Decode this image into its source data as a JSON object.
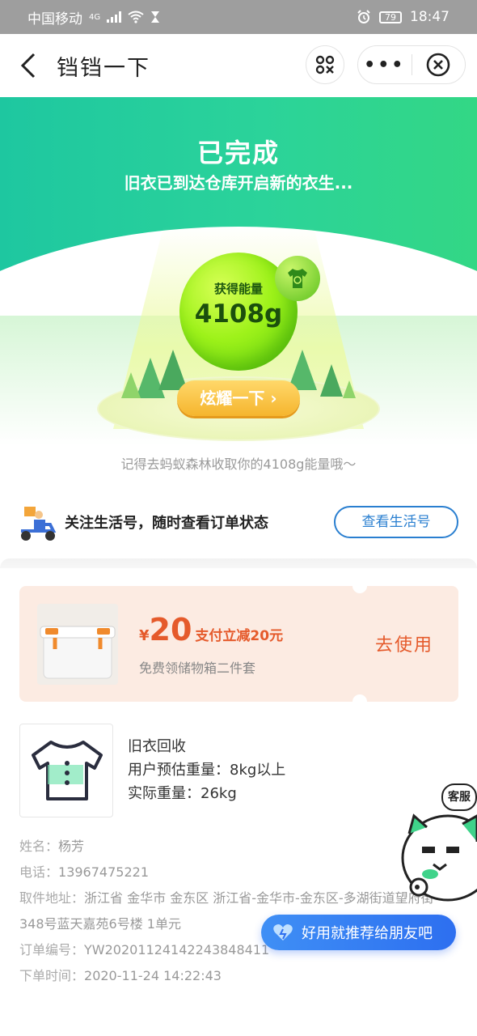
{
  "status_bar": {
    "carrier": "中国移动",
    "network": "4G",
    "battery": "79",
    "time": "18:47"
  },
  "nav": {
    "title": "铛铛一下"
  },
  "hero": {
    "title": "已完成",
    "subtitle": "旧衣已到达仓库开启新的衣生...",
    "energy_label": "获得能量",
    "energy_value": "4108g",
    "show_button": "炫耀一下 ›",
    "reminder": "记得去蚂蚁森林收取你的4108g能量哦～"
  },
  "follow": {
    "text": "关注生活号，随时查看订单状态",
    "button": "查看生活号"
  },
  "coupon": {
    "currency": "¥",
    "amount": "20",
    "desc_main": "支付立减20元",
    "desc_sub": "免费领储物箱二件套",
    "use_button": "去使用"
  },
  "product": {
    "name": "旧衣回收",
    "estimated_weight": "用户预估重量：8kg以上",
    "actual_weight": "实际重量：26kg"
  },
  "details": {
    "name_label": "姓名：",
    "name_value": "杨芳",
    "phone_label": "电话：",
    "phone_value": "13967475221",
    "address_label": "取件地址：",
    "address_value": "浙江省 金华市 金东区 浙江省-金华市-金东区-多湖街道望府街348号蓝天嘉苑6号楼 1单元",
    "order_label": "订单编号：",
    "order_value": "YW20201124142243848411",
    "time_label": "下单时间：",
    "time_value": "2020-11-24 14:22:43"
  },
  "floating": {
    "customer_service": "客服",
    "recommend": "好用就推荐给朋友吧"
  }
}
